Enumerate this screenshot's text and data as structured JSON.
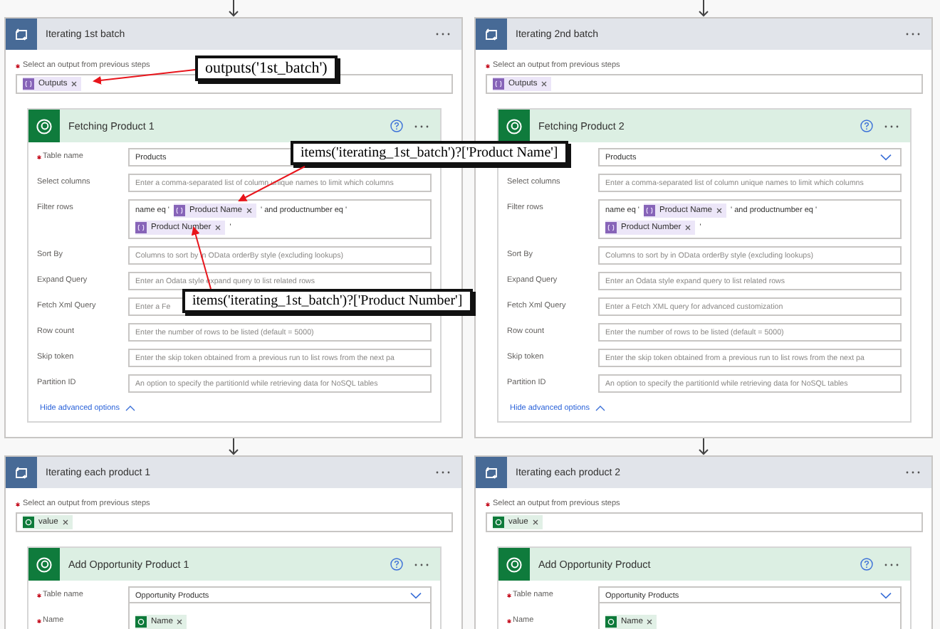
{
  "flows": [
    {
      "loop": {
        "title": "Iterating 1st batch",
        "select_label": "Select an output from previous steps",
        "select_required": true,
        "tokens": [
          {
            "text": "Outputs",
            "kind": "expression"
          }
        ]
      },
      "action": {
        "title": "Fetching Product 1",
        "fields": [
          {
            "label": "Table name",
            "required": true,
            "kind": "value",
            "value": "Products"
          },
          {
            "label": "Select columns",
            "required": false,
            "kind": "text",
            "placeholder": "Enter a comma-separated list of column unique names to limit which columns"
          },
          {
            "label": "Filter rows",
            "required": false,
            "kind": "filter",
            "parts": [
              {
                "kind": "text",
                "text": "name eq '"
              },
              {
                "kind": "expression",
                "text": "Product Name"
              },
              {
                "kind": "text",
                "text": "' and productnumber eq '"
              },
              {
                "kind": "expression",
                "text": "Product Number"
              },
              {
                "kind": "text",
                "text": "'"
              }
            ]
          },
          {
            "label": "Sort By",
            "required": false,
            "kind": "text",
            "placeholder": "Columns to sort by in OData orderBy style (excluding lookups)"
          },
          {
            "label": "Expand Query",
            "required": false,
            "kind": "text",
            "placeholder": "Enter an Odata style expand query to list related rows"
          },
          {
            "label": "Fetch Xml Query",
            "required": false,
            "kind": "text",
            "placeholder": "Enter a Fe"
          },
          {
            "label": "Row count",
            "required": false,
            "kind": "text",
            "placeholder": "Enter the number of rows to be listed (default = 5000)"
          },
          {
            "label": "Skip token",
            "required": false,
            "kind": "text",
            "placeholder": "Enter the skip token obtained from a previous run to list rows from the next pa"
          },
          {
            "label": "Partition ID",
            "required": false,
            "kind": "text",
            "placeholder": "An option to specify the partitionId while retrieving data for NoSQL tables"
          }
        ],
        "link": "Hide advanced options"
      },
      "loop2": {
        "title": "Iterating each product 1",
        "select_label": "Select an output from previous steps",
        "select_required": true,
        "tokens": [
          {
            "text": "value",
            "kind": "dataverse"
          }
        ]
      },
      "action2": {
        "title": "Add Opportunity Product 1",
        "fields": [
          {
            "label": "Table name",
            "required": true,
            "kind": "dropdown",
            "value": "Opportunity Products"
          },
          {
            "label": "Name",
            "required": true,
            "kind": "tokens",
            "tokens": [
              {
                "text": "Name",
                "kind": "dataverse"
              }
            ]
          }
        ]
      }
    },
    {
      "loop": {
        "title": "Iterating 2nd batch",
        "select_label": "Select an output from previous steps",
        "select_required": true,
        "tokens": [
          {
            "text": "Outputs",
            "kind": "expression"
          }
        ]
      },
      "action": {
        "title": "Fetching Product 2",
        "fields": [
          {
            "kind": "dropdown",
            "value": "Products"
          },
          {
            "label": "Select columns",
            "required": false,
            "kind": "text",
            "placeholder": "Enter a comma-separated list of column unique names to limit which columns"
          },
          {
            "label": "Filter rows",
            "required": false,
            "kind": "filter",
            "parts": [
              {
                "kind": "text",
                "text": "name eq '"
              },
              {
                "kind": "expression",
                "text": "Product Name"
              },
              {
                "kind": "text",
                "text": "' and productnumber eq '"
              },
              {
                "kind": "expression",
                "text": "Product Number"
              },
              {
                "kind": "text",
                "text": "'"
              }
            ]
          },
          {
            "label": "Sort By",
            "required": false,
            "kind": "text",
            "placeholder": "Columns to sort by in OData orderBy style (excluding lookups)"
          },
          {
            "label": "Expand Query",
            "required": false,
            "kind": "text",
            "placeholder": "Enter an Odata style expand query to list related rows"
          },
          {
            "label": "Fetch Xml Query",
            "required": false,
            "kind": "text",
            "placeholder": "Enter a Fetch XML query for advanced customization"
          },
          {
            "label": "Row count",
            "required": false,
            "kind": "text",
            "placeholder": "Enter the number of rows to be listed (default = 5000)"
          },
          {
            "label": "Skip token",
            "required": false,
            "kind": "text",
            "placeholder": "Enter the skip token obtained from a previous run to list rows from the next pa"
          },
          {
            "label": "Partition ID",
            "required": false,
            "kind": "text",
            "placeholder": "An option to specify the partitionId while retrieving data for NoSQL tables"
          }
        ],
        "link": "Hide advanced options"
      },
      "loop2": {
        "title": "Iterating each product 2",
        "select_label": "Select an output from previous steps",
        "select_required": true,
        "tokens": [
          {
            "text": "value",
            "kind": "dataverse"
          }
        ]
      },
      "action2": {
        "title": "Add Opportunity Product",
        "fields": [
          {
            "label": "Table name",
            "required": true,
            "kind": "dropdown",
            "value": "Opportunity Products"
          },
          {
            "label": "Name",
            "required": true,
            "kind": "tokens",
            "tokens": [
              {
                "text": "Name",
                "kind": "dataverse"
              }
            ]
          }
        ]
      }
    }
  ],
  "annotations": [
    {
      "text": "outputs('1st_batch')"
    },
    {
      "text": "items('iterating_1st_batch')?['Product Name']"
    },
    {
      "text": "items('iterating_1st_batch')?['Product Number']"
    }
  ]
}
